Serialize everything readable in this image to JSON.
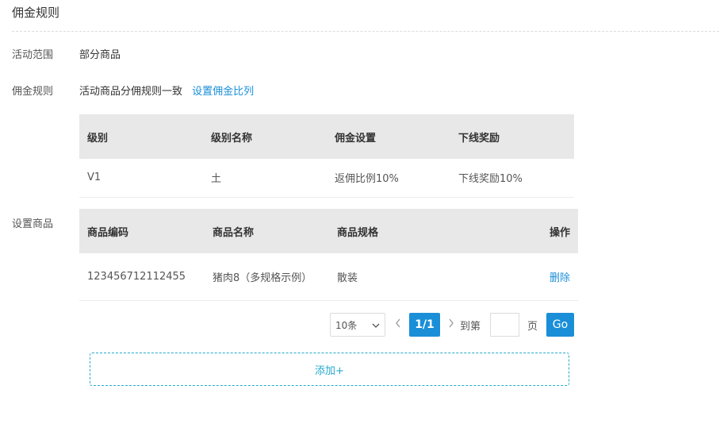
{
  "page": {
    "title": "佣金规则"
  },
  "activity_scope": {
    "label": "活动范围",
    "value": "部分商品"
  },
  "commission_rule": {
    "label": "佣金规则",
    "value": "活动商品分佣规则一致",
    "link": "设置佣金比列"
  },
  "rules_table": {
    "headers": [
      "级别",
      "级别名称",
      "佣金设置",
      "下线奖励"
    ],
    "rows": [
      [
        "V1",
        "土",
        "返佣比例10%",
        "下线奖励10%"
      ]
    ]
  },
  "set_goods": {
    "label": "设置商品"
  },
  "goods_table": {
    "headers": [
      "商品编码",
      "商品名称",
      "商品规格",
      "操作"
    ],
    "rows": [
      {
        "code": "123456712112455",
        "name": "猪肉8（多规格示例）",
        "spec": "散装",
        "action": "删除"
      }
    ]
  },
  "pagination": {
    "page_size": "10条",
    "current": "1/1",
    "goto_label": "到第",
    "page_label": "页",
    "go_label": "Go"
  },
  "add_button": {
    "label": "添加+"
  },
  "colors": {
    "accent": "#1a8fd8",
    "add_border": "#26aacd",
    "header_bg": "#e8e8e8"
  }
}
